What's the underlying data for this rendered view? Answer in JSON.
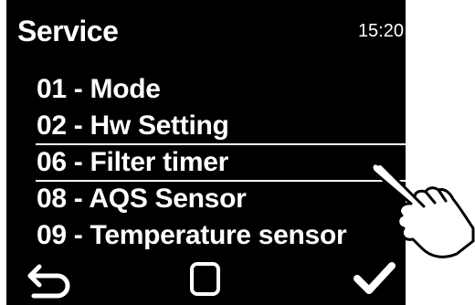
{
  "header": {
    "title": "Service",
    "time": "15:20"
  },
  "menu": {
    "items": [
      {
        "label": "01 - Mode",
        "selected": false
      },
      {
        "label": "02 - Hw Setting",
        "selected": false
      },
      {
        "label": "06 - Filter timer",
        "selected": true
      },
      {
        "label": "08 - AQS Sensor",
        "selected": false
      },
      {
        "label": "09 - Temperature sensor",
        "selected": false
      }
    ]
  },
  "softkeys": {
    "back_icon": "back-arrow-icon",
    "home_icon": "square-icon",
    "confirm_icon": "checkmark-icon"
  },
  "overlay": {
    "icon": "pointing-hand-icon"
  },
  "colors": {
    "background": "#000000",
    "text": "#ffffff"
  }
}
